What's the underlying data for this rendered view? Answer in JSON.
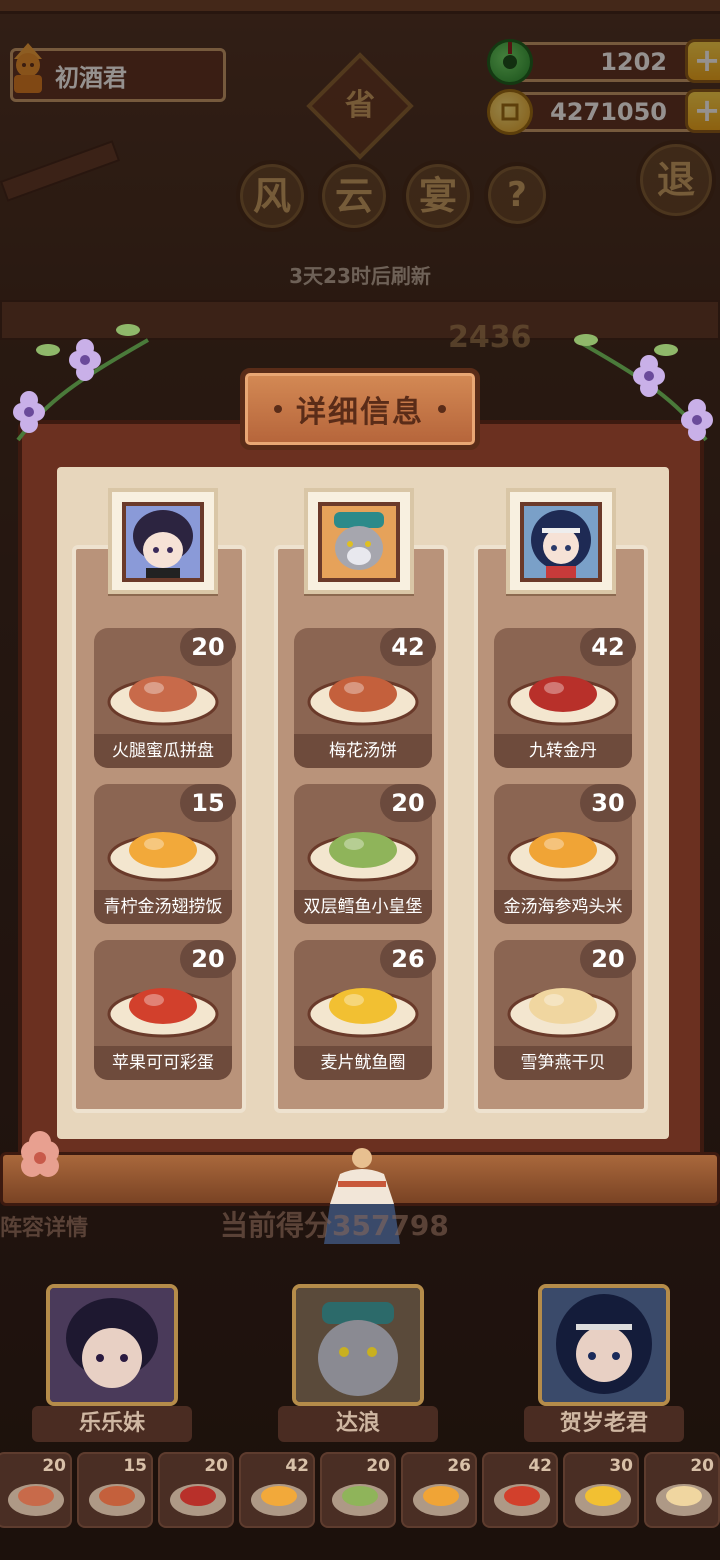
{
  "player": {
    "name": "初酒君"
  },
  "currencies": [
    {
      "id": "jade",
      "value": "1202",
      "icon": "jade-icon",
      "color": "#2fae3a"
    },
    {
      "id": "coin",
      "value": "4271050",
      "icon": "coin-icon",
      "color": "#f3c12c"
    }
  ],
  "event": {
    "badge": "省",
    "title_chars": [
      "风",
      "云",
      "宴"
    ],
    "help": "?",
    "exit": "退",
    "refresh": "3天23时后刷新",
    "behind_score": "2436",
    "current_score": "当前得分357798",
    "lineup_label": "阵容详情"
  },
  "panel": {
    "title": "详细信息",
    "columns": [
      {
        "character": "乐乐妹",
        "dishes": [
          {
            "name": "火腿蜜瓜拼盘",
            "count": "20",
            "color": "#c86a4a"
          },
          {
            "name": "青柠金汤翅捞饭",
            "count": "15",
            "color": "#f2a93a"
          },
          {
            "name": "苹果可可彩蛋",
            "count": "20",
            "color": "#d2402c"
          }
        ]
      },
      {
        "character": "达浪",
        "dishes": [
          {
            "name": "梅花汤饼",
            "count": "42",
            "color": "#c4603c"
          },
          {
            "name": "双层鳕鱼小皇堡",
            "count": "20",
            "color": "#8fb45a"
          },
          {
            "name": "麦片鱿鱼圈",
            "count": "26",
            "color": "#f2c032"
          }
        ]
      },
      {
        "character": "贺岁老君",
        "dishes": [
          {
            "name": "九转金丹",
            "count": "42",
            "color": "#b8302a"
          },
          {
            "name": "金汤海参鸡头米",
            "count": "30",
            "color": "#f0a436"
          },
          {
            "name": "雪笋燕干贝",
            "count": "20",
            "color": "#f0d6a0"
          }
        ]
      }
    ]
  },
  "bottom_strip": {
    "counts": [
      "20",
      "15",
      "20",
      "42",
      "20",
      "26",
      "42",
      "30",
      "20"
    ]
  }
}
